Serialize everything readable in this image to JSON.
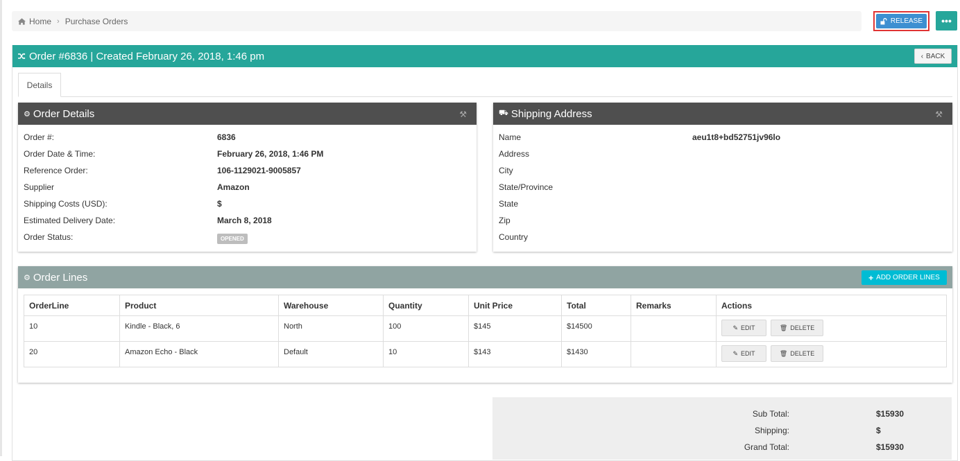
{
  "breadcrumb": {
    "home": "Home",
    "current": "Purchase Orders"
  },
  "actions": {
    "release_label": "RELEASE",
    "more_label": "•••"
  },
  "order": {
    "title": "Order #6836 | Created February 26, 2018, 1:46 pm",
    "back_label": "BACK"
  },
  "tabs": [
    {
      "label": "Details"
    }
  ],
  "order_details": {
    "title": "Order Details",
    "rows": [
      {
        "label": "Order #:",
        "value": "6836"
      },
      {
        "label": "Order Date & Time:",
        "value": "February 26, 2018, 1:46 PM"
      },
      {
        "label": "Reference Order:",
        "value": "106-1129021-9005857"
      },
      {
        "label": "Supplier",
        "value": "Amazon"
      },
      {
        "label": "Shipping Costs (USD):",
        "value": "$"
      },
      {
        "label": "Estimated Delivery Date:",
        "value": "March 8, 2018"
      },
      {
        "label": "Order Status:",
        "value": "OPENED"
      }
    ]
  },
  "shipping_address": {
    "title": "Shipping Address",
    "rows": [
      {
        "label": "Name",
        "value": "aeu1t8+bd52751jv96lo"
      },
      {
        "label": "Address",
        "value": ""
      },
      {
        "label": "City",
        "value": ""
      },
      {
        "label": "State/Province",
        "value": ""
      },
      {
        "label": "State",
        "value": ""
      },
      {
        "label": "Zip",
        "value": ""
      },
      {
        "label": "Country",
        "value": ""
      }
    ]
  },
  "order_lines": {
    "title": "Order Lines",
    "add_label": "ADD ORDER LINES",
    "columns": [
      "OrderLine",
      "Product",
      "Warehouse",
      "Quantity",
      "Unit Price",
      "Total",
      "Remarks",
      "Actions"
    ],
    "rows": [
      {
        "orderline": "10",
        "product": "Kindle - Black, 6",
        "warehouse": "North",
        "quantity": "100",
        "unit_price": "$145",
        "total": "$14500",
        "remarks": ""
      },
      {
        "orderline": "20",
        "product": "Amazon Echo - Black",
        "warehouse": "Default",
        "quantity": "10",
        "unit_price": "$143",
        "total": "$1430",
        "remarks": ""
      }
    ],
    "edit_label": "EDIT",
    "delete_label": "DELETE"
  },
  "totals": {
    "sub_total_label": "Sub Total:",
    "sub_total": "$15930",
    "shipping_label": "Shipping:",
    "shipping": "$",
    "grand_total_label": "Grand Total:",
    "grand_total": "$15930"
  },
  "colors": {
    "teal": "#26a69a",
    "blue": "#3d8fd1",
    "dark_header": "#4f4f4f",
    "lines_header": "#90a4a2",
    "cyan": "#00bcd4",
    "highlight_border": "#e03434"
  }
}
